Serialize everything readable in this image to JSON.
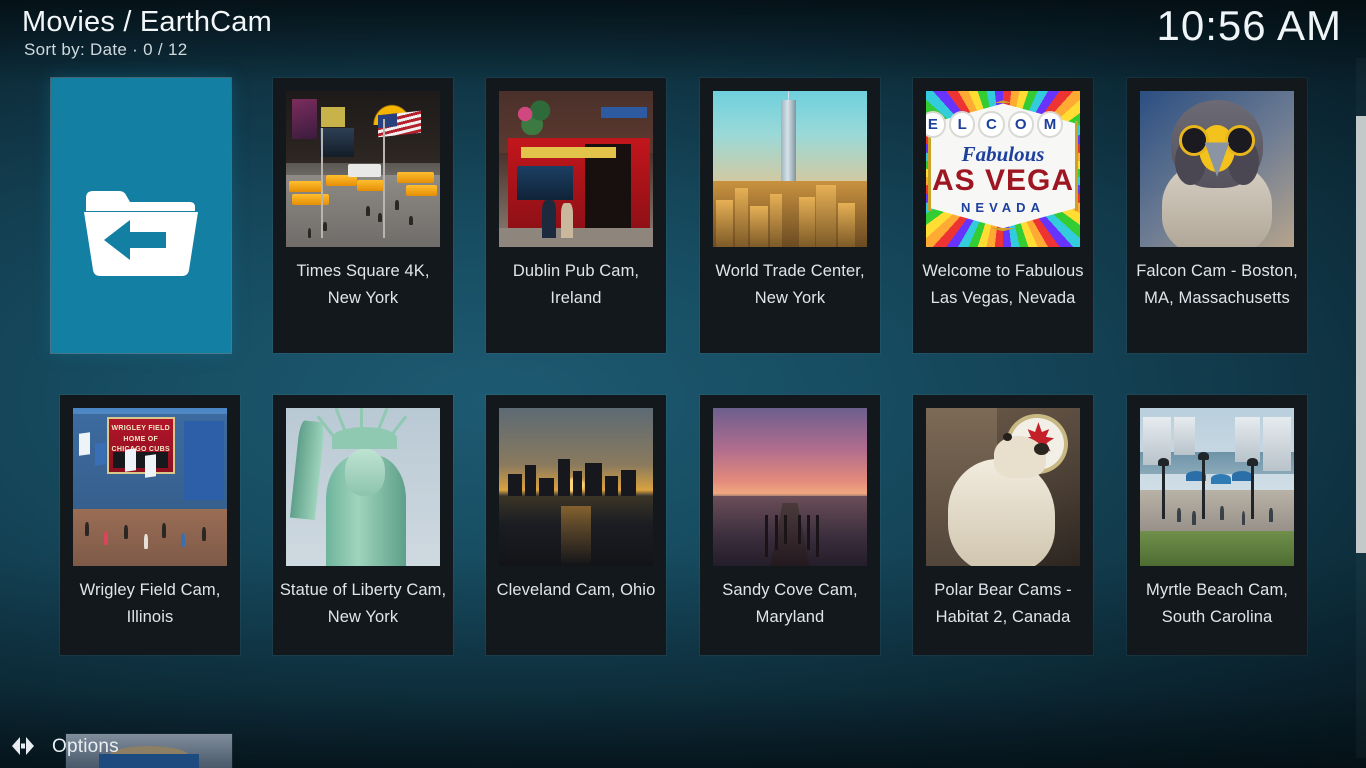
{
  "header": {
    "title": "Movies / EarthCam",
    "subtitle": "Sort by: Date  ·  0 / 12",
    "clock": "10:56 AM"
  },
  "colors": {
    "selection": "#127FA3",
    "tile_bg": "#12181b",
    "text": "#dfe6ea",
    "scrollbar": "#c3c8c9"
  },
  "grid": {
    "rows": [
      {
        "items": [
          {
            "label": "",
            "icon": "folder-back-icon",
            "selected": true,
            "kind": "parent-folder"
          },
          {
            "label": "Times Square 4K, New York",
            "selected": false,
            "kind": "video"
          },
          {
            "label": "Dublin Pub Cam, Ireland",
            "selected": false,
            "kind": "video"
          },
          {
            "label": "World Trade Center, New York",
            "selected": false,
            "kind": "video"
          },
          {
            "label": "Welcome to Fabulous Las Vegas, Nevada",
            "selected": false,
            "kind": "video"
          },
          {
            "label": "Falcon Cam - Boston, MA, Massachusetts",
            "selected": false,
            "kind": "video"
          }
        ]
      },
      {
        "items": [
          {
            "label": "Wrigley Field Cam, Illinois",
            "selected": false,
            "kind": "video"
          },
          {
            "label": "Statue of Liberty Cam, New York",
            "selected": false,
            "kind": "video"
          },
          {
            "label": "Cleveland Cam, Ohio",
            "selected": false,
            "kind": "video"
          },
          {
            "label": "Sandy Cove Cam, Maryland",
            "selected": false,
            "kind": "video"
          },
          {
            "label": "Polar Bear Cams - Habitat 2, Canada",
            "selected": false,
            "kind": "video"
          },
          {
            "label": "Myrtle Beach Cam, South Carolina",
            "selected": false,
            "kind": "video"
          }
        ]
      }
    ]
  },
  "vegas_sign": {
    "circles": [
      "E",
      "L",
      "C",
      "O",
      "M"
    ],
    "script": "Fabulous",
    "city": "AS VEGA",
    "state": "NEVADA"
  },
  "wrigley_sign": {
    "line1": "WRIGLEY FIELD",
    "line2": "HOME OF",
    "line3": "CHICAGO CUBS"
  },
  "footer": {
    "options_label": "Options",
    "options_icon": "left-right-arrows-icon"
  }
}
